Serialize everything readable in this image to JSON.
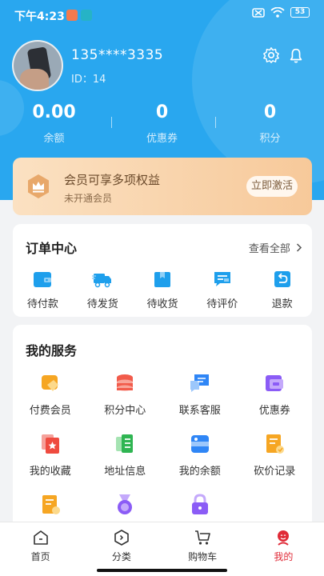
{
  "status_bar": {
    "time": "下午4:23",
    "battery": "53"
  },
  "profile": {
    "username": "135****3335",
    "user_id": "ID：14"
  },
  "stats": [
    {
      "value": "0.00",
      "label": "余额"
    },
    {
      "value": "0",
      "label": "优惠券"
    },
    {
      "value": "0",
      "label": "积分"
    }
  ],
  "vip": {
    "title": "会员可享多项权益",
    "subtitle": "未开通会员",
    "button": "立即激活"
  },
  "orders": {
    "title": "订单中心",
    "view_all": "查看全部",
    "items": [
      "待付款",
      "待发货",
      "待收货",
      "待评价",
      "退款"
    ]
  },
  "services": {
    "title": "我的服务",
    "items": [
      "付费会员",
      "积分中心",
      "联系客服",
      "优惠券",
      "我的收藏",
      "地址信息",
      "我的余额",
      "砍价记录",
      "",
      "",
      ""
    ]
  },
  "tabbar": {
    "items": [
      "首页",
      "分类",
      "购物车",
      "我的"
    ],
    "active": "我的"
  },
  "colors": {
    "header_blue": "#29a7ef",
    "accent_red": "#e02a37",
    "vip_gold": "#f7c99a"
  }
}
